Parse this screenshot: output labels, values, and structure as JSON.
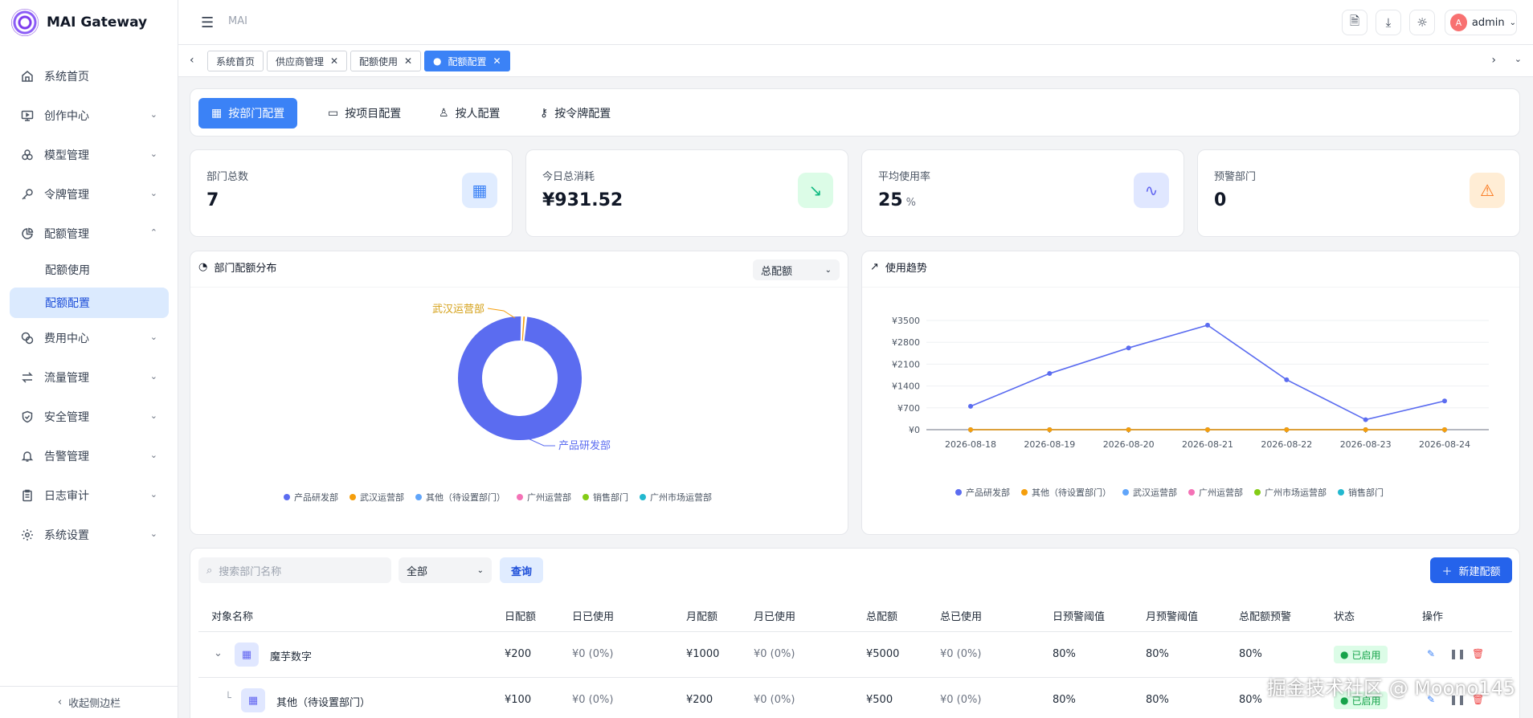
{
  "app": {
    "title": "MAI Gateway"
  },
  "sidebar": {
    "items": [
      {
        "label": "系统首页",
        "icon": "home-icon"
      },
      {
        "label": "创作中心",
        "icon": "monitor-icon"
      },
      {
        "label": "模型管理",
        "icon": "cubes-icon"
      },
      {
        "label": "令牌管理",
        "icon": "key-icon"
      },
      {
        "label": "配额管理",
        "icon": "pie-icon"
      },
      {
        "label": "费用中心",
        "icon": "coins-icon"
      },
      {
        "label": "流量管理",
        "icon": "arrows-icon"
      },
      {
        "label": "安全管理",
        "icon": "shield-icon"
      },
      {
        "label": "告警管理",
        "icon": "bell-icon"
      },
      {
        "label": "日志审计",
        "icon": "clipboard-icon"
      },
      {
        "label": "系统设置",
        "icon": "gear-icon"
      }
    ],
    "sub": [
      "配额使用",
      "配额配置"
    ],
    "collapse": "收起侧边栏"
  },
  "topbar": {
    "breadcrumb": "MAI",
    "user": "admin",
    "avatar": "A"
  },
  "tabs": [
    {
      "label": "系统首页"
    },
    {
      "label": "供应商管理"
    },
    {
      "label": "配额使用"
    },
    {
      "label": "配额配置"
    }
  ],
  "segments": [
    "按部门配置",
    "按项目配置",
    "按人配置",
    "按令牌配置"
  ],
  "stats": [
    {
      "label": "部门总数",
      "value": "7",
      "unit": "",
      "color": "#3b82f6",
      "bg": "#e0ecff"
    },
    {
      "label": "今日总消耗",
      "value": "¥931.52",
      "unit": "",
      "color": "#10b981",
      "bg": "#dcfce7"
    },
    {
      "label": "平均使用率",
      "value": "25",
      "unit": "%",
      "color": "#6366f1",
      "bg": "#e0e7ff"
    },
    {
      "label": "预警部门",
      "value": "0",
      "unit": "",
      "color": "#f97316",
      "bg": "#ffedd5"
    }
  ],
  "pie_panel": {
    "title": "部门配额分布",
    "select": "总配额"
  },
  "trend_panel": {
    "title": "使用趋势"
  },
  "chart_data": [
    {
      "type": "pie",
      "labels": [
        "产品研发部",
        "武汉运营部"
      ],
      "values": [
        99,
        1
      ],
      "legend": [
        "产品研发部",
        "武汉运营部",
        "其他（待设置部门）",
        "广州运营部",
        "销售部门",
        "广州市场运营部"
      ],
      "legend_colors": [
        "#5b6cf0",
        "#f59e0b",
        "#60a5fa",
        "#f472b6",
        "#84cc16",
        "#22b8cf"
      ]
    },
    {
      "type": "line",
      "x": [
        "2026-08-18",
        "2026-08-19",
        "2026-08-20",
        "2026-08-21",
        "2026-08-22",
        "2026-08-23",
        "2026-08-24"
      ],
      "yticks": [
        "¥0",
        "¥700",
        "¥1400",
        "¥2100",
        "¥2800",
        "¥3500"
      ],
      "ylim": [
        0,
        3500
      ],
      "series": [
        {
          "name": "产品研发部",
          "color": "#5b6cf0",
          "values": [
            750,
            1800,
            2620,
            3350,
            1600,
            320,
            920
          ]
        },
        {
          "name": "其他（待设置部门）",
          "color": "#f59e0b",
          "values": [
            0,
            0,
            0,
            0,
            0,
            0,
            0
          ]
        },
        {
          "name": "武汉运营部",
          "color": "#60a5fa",
          "values": [
            0,
            0,
            0,
            0,
            0,
            0,
            0
          ]
        },
        {
          "name": "广州运营部",
          "color": "#f472b6",
          "values": [
            0,
            0,
            0,
            0,
            0,
            0,
            0
          ]
        },
        {
          "name": "广州市场运营部",
          "color": "#84cc16",
          "values": [
            0,
            0,
            0,
            0,
            0,
            0,
            0
          ]
        },
        {
          "name": "销售部门",
          "color": "#22b8cf",
          "values": [
            0,
            0,
            0,
            0,
            0,
            0,
            0
          ]
        }
      ]
    }
  ],
  "filters": {
    "search_placeholder": "搜索部门名称",
    "select": "全部",
    "query": "查询",
    "new": "新建配额"
  },
  "table": {
    "headers": [
      "对象名称",
      "日配额",
      "日已使用",
      "月配额",
      "月已使用",
      "总配额",
      "总已使用",
      "日预警阈值",
      "月预警阈值",
      "总配额预警",
      "状态",
      "操作"
    ],
    "rows": [
      {
        "name": "魔芋数字",
        "daily": "¥200",
        "daily_used": "¥0 (0%)",
        "monthly": "¥1000",
        "monthly_used": "¥0 (0%)",
        "total": "¥5000",
        "total_used": "¥0 (0%)",
        "dw": "80%",
        "mw": "80%",
        "tw": "80%",
        "status": "已启用"
      },
      {
        "name": "其他（待设置部门）",
        "daily": "¥100",
        "daily_used": "¥0 (0%)",
        "monthly": "¥200",
        "monthly_used": "¥0 (0%)",
        "total": "¥500",
        "total_used": "¥0 (0%)",
        "dw": "80%",
        "mw": "80%",
        "tw": "80%",
        "status": "已启用"
      }
    ]
  },
  "watermark": "掘金技术社区 @ Moono145"
}
